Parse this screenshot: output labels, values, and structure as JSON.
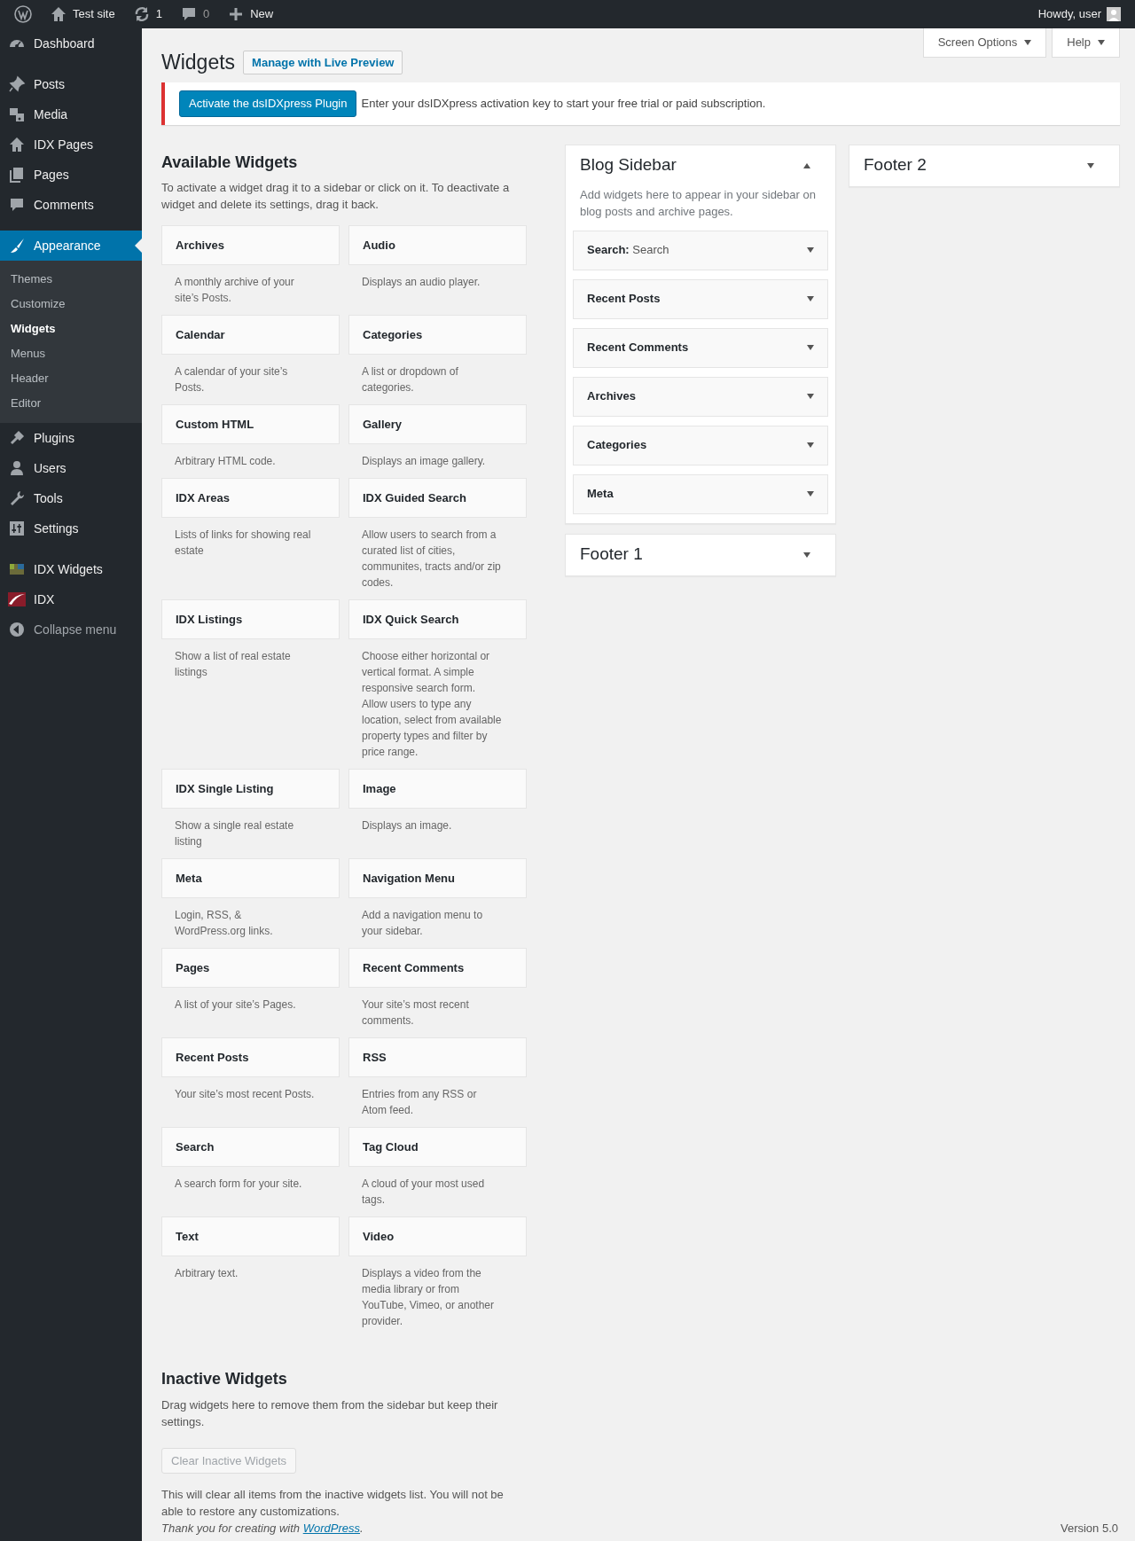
{
  "admin_bar": {
    "site": "Test site",
    "updates": "1",
    "comments": "0",
    "new": "New",
    "account": "Howdy, user"
  },
  "menu": {
    "groups": [
      {
        "items": [
          {
            "label": "Dashboard",
            "selected": false
          }
        ]
      },
      {
        "items": [
          {
            "label": "Posts",
            "selected": false
          },
          {
            "label": "Media",
            "selected": false
          },
          {
            "label": "IDX Pages",
            "selected": false
          },
          {
            "label": "Pages",
            "selected": false
          },
          {
            "label": "Comments",
            "selected": false
          }
        ]
      },
      {
        "items": [
          {
            "label": "Appearance",
            "selected": true,
            "children": [
              {
                "label": "Themes",
                "selected": false
              },
              {
                "label": "Customize",
                "selected": false
              },
              {
                "label": "Widgets",
                "selected": true
              },
              {
                "label": "Menus",
                "selected": false
              },
              {
                "label": "Header",
                "selected": false
              },
              {
                "label": "Editor",
                "selected": false
              }
            ]
          },
          {
            "label": "Plugins",
            "selected": false
          },
          {
            "label": "Users",
            "selected": false
          },
          {
            "label": "Tools",
            "selected": false
          },
          {
            "label": "Settings",
            "selected": false
          }
        ]
      },
      {
        "items": [
          {
            "label": "IDX Widgets",
            "selected": false
          },
          {
            "label": "IDX",
            "selected": false
          }
        ]
      }
    ],
    "collapse": "Collapse menu"
  },
  "screen_tabs": [
    "Screen Options",
    "Help"
  ],
  "page": {
    "title": "Widgets",
    "action": "Manage with Live Preview"
  },
  "notice": {
    "button": "Activate the dsIDXpress Plugin",
    "text": "Enter your dsIDXpress activation key to start your free trial or paid subscription."
  },
  "available": {
    "title": "Available Widgets",
    "description": "To activate a widget drag it to a sidebar or click on it. To deactivate a widget and delete its settings, drag it back.",
    "widgets": [
      {
        "title": "Archives",
        "description": "A monthly archive of your site’s Posts."
      },
      {
        "title": "Audio",
        "description": "Displays an audio player."
      },
      {
        "title": "Calendar",
        "description": "A calendar of your site’s Posts."
      },
      {
        "title": "Categories",
        "description": "A list or dropdown of categories."
      },
      {
        "title": "Custom HTML",
        "description": "Arbitrary HTML code."
      },
      {
        "title": "Gallery",
        "description": "Displays an image gallery."
      },
      {
        "title": "IDX Areas",
        "description": "Lists of links for showing real estate"
      },
      {
        "title": "IDX Guided Search",
        "description": "Allow users to search from a curated list of cities, communites, tracts and/or zip codes."
      },
      {
        "title": "IDX Listings",
        "description": "Show a list of real estate listings"
      },
      {
        "title": "IDX Quick Search",
        "description": "Choose either horizontal or vertical format. A simple responsive search form. Allow users to type any location, select from available property types and filter by price range."
      },
      {
        "title": "IDX Single Listing",
        "description": "Show a single real estate listing"
      },
      {
        "title": "Image",
        "description": "Displays an image."
      },
      {
        "title": "Meta",
        "description": "Login, RSS, & WordPress.org links."
      },
      {
        "title": "Navigation Menu",
        "description": "Add a navigation menu to your sidebar."
      },
      {
        "title": "Pages",
        "description": "A list of your site’s Pages."
      },
      {
        "title": "Recent Comments",
        "description": "Your site’s most recent comments."
      },
      {
        "title": "Recent Posts",
        "description": "Your site’s most recent Posts."
      },
      {
        "title": "RSS",
        "description": "Entries from any RSS or Atom feed."
      },
      {
        "title": "Search",
        "description": "A search form for your site."
      },
      {
        "title": "Tag Cloud",
        "description": "A cloud of your most used tags."
      },
      {
        "title": "Text",
        "description": "Arbitrary text."
      },
      {
        "title": "Video",
        "description": "Displays a video from the media library or from YouTube, Vimeo, or another provider."
      }
    ]
  },
  "sidebar_columns": [
    [
      {
        "title": "Blog Sidebar",
        "expanded": true,
        "description": "Add widgets here to appear in your sidebar on blog posts and archive pages.",
        "widgets": [
          {
            "title": "Search:",
            "instance": "Search"
          },
          {
            "title": "Recent Posts"
          },
          {
            "title": "Recent Comments"
          },
          {
            "title": "Archives"
          },
          {
            "title": "Categories"
          },
          {
            "title": "Meta"
          }
        ]
      },
      {
        "title": "Footer 1",
        "expanded": false
      }
    ],
    [
      {
        "title": "Footer 2",
        "expanded": false
      }
    ]
  ],
  "inactive": {
    "title": "Inactive Widgets",
    "description": "Drag widgets here to remove them from the sidebar but keep their settings.",
    "button": "Clear Inactive Widgets",
    "disabled": true,
    "note": "This will clear all items from the inactive widgets list. You will not be able to restore any customizations."
  },
  "footer": {
    "thanks": "Thank you for creating with ",
    "link": "WordPress",
    "end": ".",
    "version": "Version 5.0"
  }
}
